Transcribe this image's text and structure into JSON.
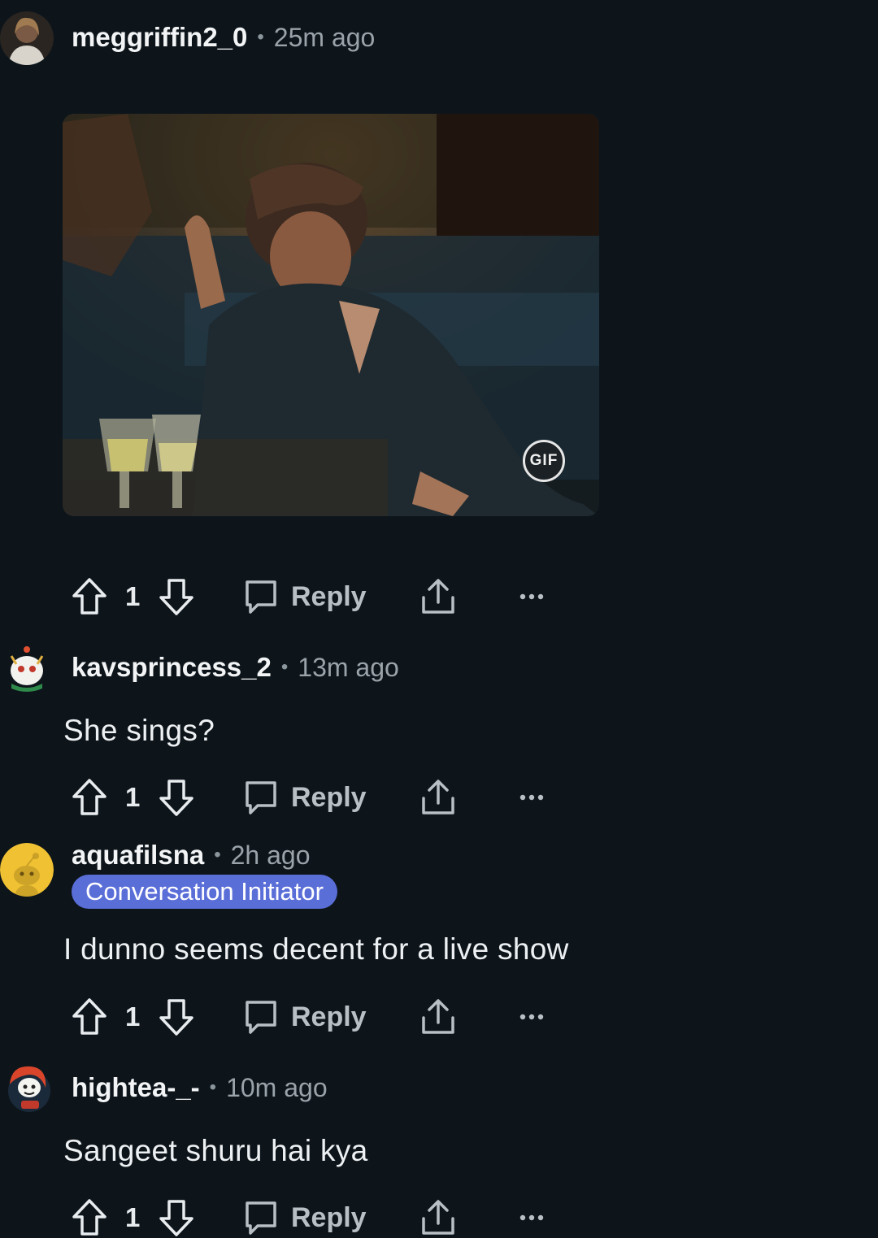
{
  "comments": [
    {
      "username": "meggriffin2_0",
      "time": "25m ago",
      "media": {
        "type": "gif",
        "badge": "GIF"
      },
      "votes": "1",
      "reply_label": "Reply"
    },
    {
      "username": "kavsprincess_2",
      "time": "13m ago",
      "text": "She sings?",
      "votes": "1",
      "reply_label": "Reply"
    },
    {
      "username": "aquafilsna",
      "time": "2h ago",
      "flair": "Conversation Initiator",
      "text": "I dunno seems decent for a live show",
      "votes": "1",
      "reply_label": "Reply"
    },
    {
      "username": "hightea-_-",
      "time": "10m ago",
      "text": "Sangeet shuru hai kya",
      "votes": "1",
      "reply_label": "Reply"
    }
  ],
  "separator": "•",
  "colors": {
    "background": "#0d151b",
    "flair_bg": "#5a6ed8",
    "username": "#f2f4f5",
    "meta": "#9aa3a9"
  },
  "icons": [
    "upvote-icon",
    "downvote-icon",
    "comment-bubble-icon",
    "share-icon",
    "more-options-icon"
  ]
}
